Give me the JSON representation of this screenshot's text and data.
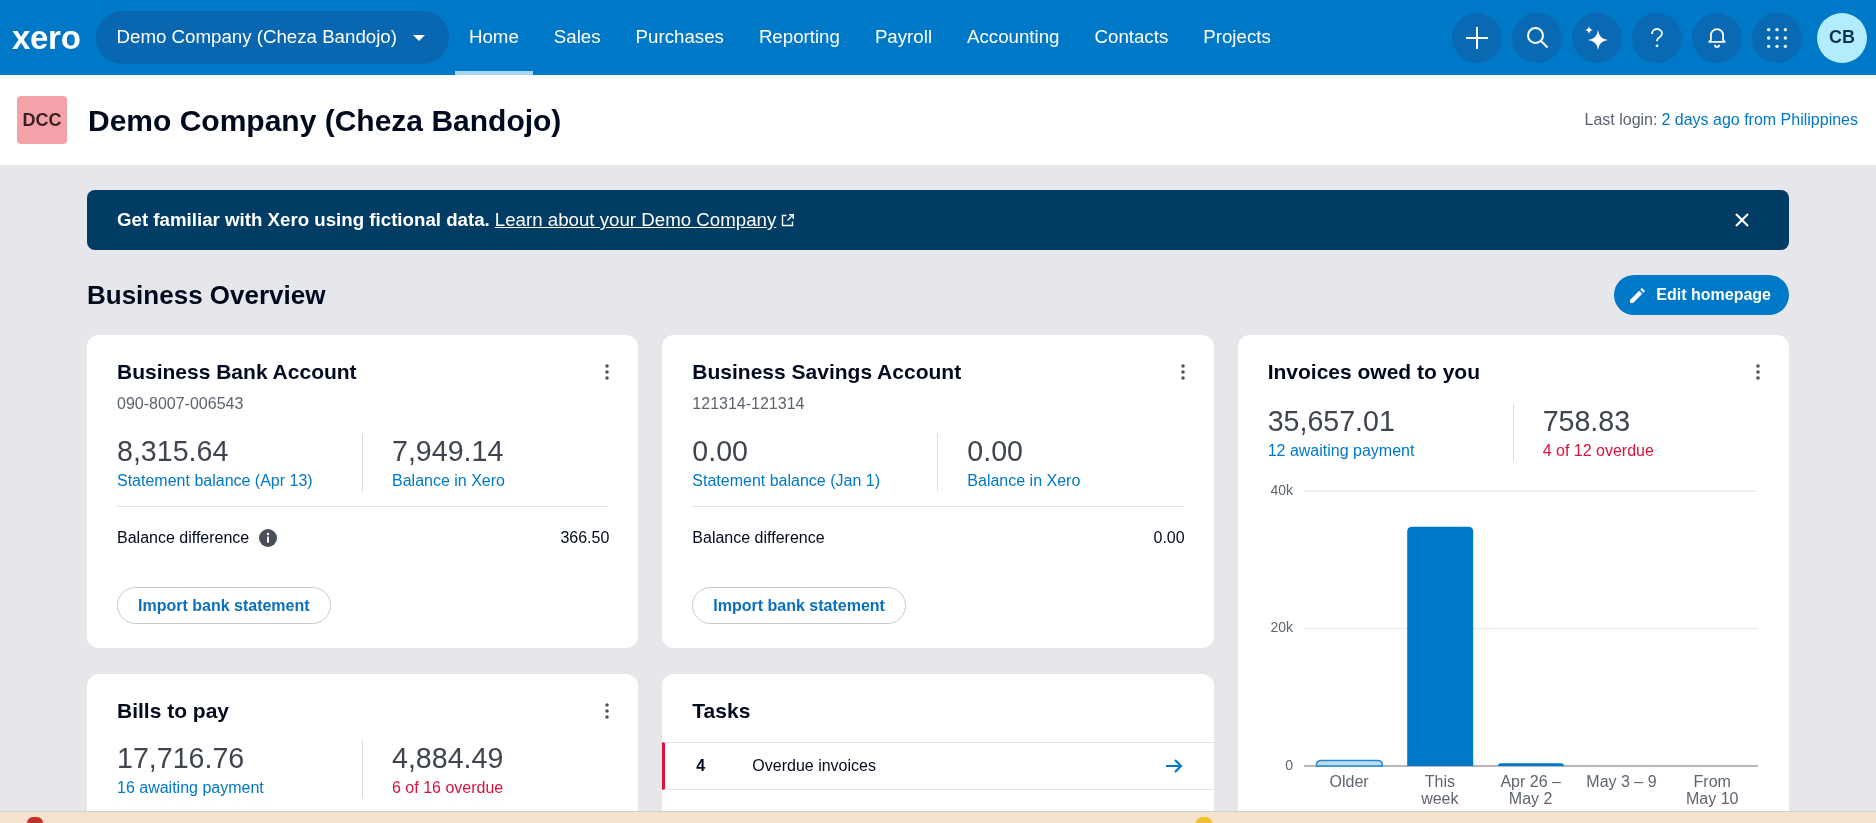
{
  "nav": {
    "logo": "xero",
    "organisation": "Demo Company (Cheza Bandojo)",
    "tabs": [
      {
        "label": "Home",
        "selected": true
      },
      {
        "label": "Sales",
        "selected": false
      },
      {
        "label": "Purchases",
        "selected": false
      },
      {
        "label": "Reporting",
        "selected": false
      },
      {
        "label": "Payroll",
        "selected": false
      },
      {
        "label": "Accounting",
        "selected": false
      },
      {
        "label": "Contacts",
        "selected": false
      },
      {
        "label": "Projects",
        "selected": false
      }
    ],
    "avatar": "CB"
  },
  "header": {
    "badge": "DCC",
    "title": "Demo Company (Cheza Bandojo)",
    "last_login_label": "Last login:",
    "last_login_link": "2 days ago from Philippines"
  },
  "banner": {
    "text": "Get familiar with Xero using fictional data.",
    "link": "Learn about your Demo Company"
  },
  "overview": {
    "title": "Business Overview",
    "edit_button": "Edit homepage"
  },
  "cards": [
    {
      "kind": "account",
      "title": "Business Bank Account",
      "account_number": "090-8007-006543",
      "figures": [
        {
          "amount": "8,315.64",
          "label": "Statement balance (Apr 13)"
        },
        {
          "amount": "7,949.14",
          "label": "Balance in Xero"
        }
      ],
      "difference_label": "Balance difference",
      "info_icon": true,
      "difference_value": "366.50",
      "button": "Import bank statement"
    },
    {
      "kind": "account",
      "title": "Business Savings Account",
      "account_number": "121314-121314",
      "figures": [
        {
          "amount": "0.00",
          "label": "Statement balance (Jan 1)"
        },
        {
          "amount": "0.00",
          "label": "Balance in Xero"
        }
      ],
      "difference_label": "Balance difference",
      "info_icon": false,
      "difference_value": "0.00",
      "button": "Import bank statement"
    },
    {
      "kind": "summary",
      "title": "Invoices owed to you",
      "figures": [
        {
          "amount": "35,657.01",
          "label": "12 awaiting payment",
          "color": "#0078c8"
        },
        {
          "amount": "758.83",
          "label": "4 of 12 overdue",
          "color": "#d9123b"
        }
      ],
      "chart_data": {
        "type": "bar",
        "categories": [
          "Older",
          "This week",
          "Apr 26 – May 2",
          "May 3 – 9",
          "From May 10"
        ],
        "series": [
          {
            "color": "#b8dff7",
            "values": [
              800,
              null,
              null,
              null,
              null
            ]
          },
          {
            "color": "#0078c8",
            "values": [
              null,
              34800,
              400,
              0,
              0
            ]
          }
        ],
        "stacked": true,
        "ylim": [
          0,
          40000
        ],
        "yticks": [
          {
            "value": 0,
            "label": "0"
          },
          {
            "value": 20000,
            "label": "20k"
          },
          {
            "value": 40000,
            "label": "40k"
          }
        ]
      }
    },
    {
      "kind": "summary",
      "title": "Bills to pay",
      "figures": [
        {
          "amount": "17,716.76",
          "label": "16 awaiting payment",
          "color": "#0078c8"
        },
        {
          "amount": "4,884.49",
          "label": "6 of 16 overdue",
          "color": "#d9123b"
        }
      ]
    },
    {
      "kind": "tasks",
      "title": "Tasks",
      "rows": [
        {
          "count": "4",
          "label": "Overdue invoices"
        }
      ]
    }
  ]
}
